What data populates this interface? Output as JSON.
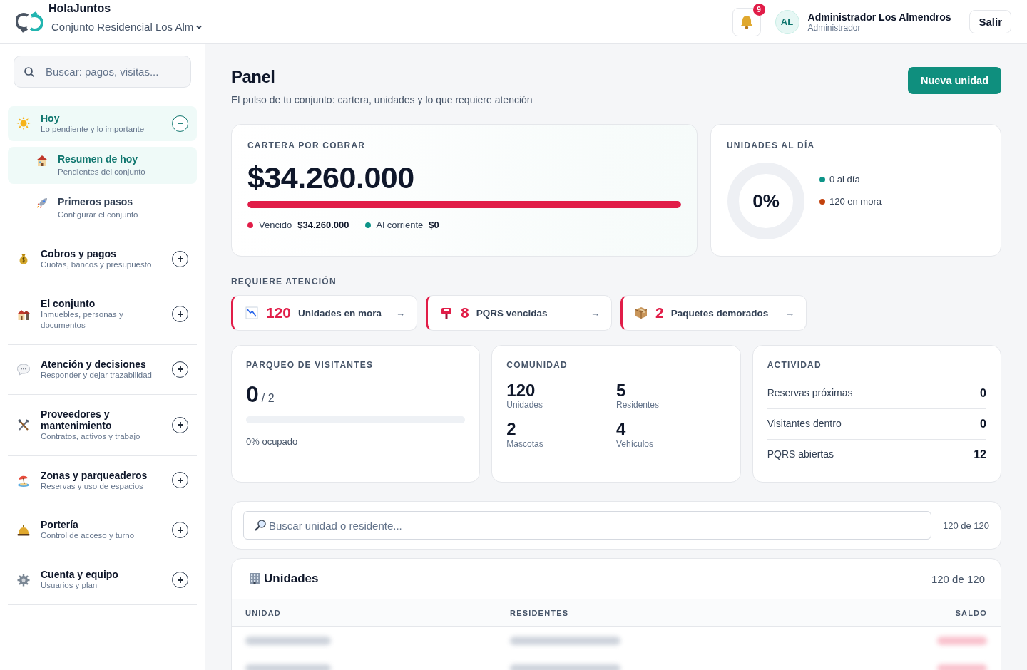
{
  "brand": {
    "name": "HolaJuntos",
    "community": "Conjunto Residencial Los Alm"
  },
  "header": {
    "notifications": "9",
    "user": {
      "initials": "AL",
      "name": "Administrador Los Almendros",
      "role": "Administrador"
    },
    "logout": "Salir"
  },
  "sidebar": {
    "search": {
      "placeholder": "Buscar: pagos, visitas..."
    },
    "sections": [
      {
        "title": "Hoy",
        "subtitle": "Lo pendiente y lo importante",
        "expanded": true,
        "children": [
          {
            "title": "Resumen de hoy",
            "subtitle": "Pendientes del conjunto",
            "selected": true
          },
          {
            "title": "Primeros pasos",
            "subtitle": "Configurar el conjunto",
            "selected": false
          }
        ]
      },
      {
        "title": "Cobros y pagos",
        "subtitle": "Cuotas, bancos y presupuesto",
        "expanded": false
      },
      {
        "title": "El conjunto",
        "subtitle": "Inmuebles, personas y documentos",
        "expanded": false
      },
      {
        "title": "Atención y decisiones",
        "subtitle": "Responder y dejar trazabilidad",
        "expanded": false
      },
      {
        "title": "Proveedores y mantenimiento",
        "subtitle": "Contratos, activos y trabajo",
        "expanded": false
      },
      {
        "title": "Zonas y parqueaderos",
        "subtitle": "Reservas y uso de espacios",
        "expanded": false
      },
      {
        "title": "Portería",
        "subtitle": "Control de acceso y turno",
        "expanded": false
      },
      {
        "title": "Cuenta y equipo",
        "subtitle": "Usuarios y plan",
        "expanded": false
      }
    ]
  },
  "page": {
    "title": "Panel",
    "subtitle": "El pulso de tu conjunto: cartera, unidades y lo que requiere atención",
    "action": "Nueva unidad"
  },
  "receivables": {
    "label": "CARTERA POR COBRAR",
    "amount": "$34.260.000",
    "level": 1,
    "legend": [
      {
        "label": "Vencido",
        "value": "$34.260.000",
        "color": "#e11d48"
      },
      {
        "label": "Al corriente",
        "value": "$0",
        "color": "#0d9488"
      }
    ]
  },
  "units_current": {
    "label": "UNIDADES AL DÍA",
    "percent": "0%",
    "level": 0,
    "legend": [
      {
        "label": "0 al día",
        "color": "#0d9488"
      },
      {
        "label": "120 en mora",
        "color": "#c2410c"
      }
    ]
  },
  "attention": {
    "title": "REQUIERE ATENCIÓN",
    "items": [
      {
        "count": "120",
        "label": "Unidades en mora",
        "arrow": "→"
      },
      {
        "count": "8",
        "label": "PQRS vencidas",
        "arrow": "→"
      },
      {
        "count": "2",
        "label": "Paquetes demorados",
        "arrow": "→"
      }
    ]
  },
  "parking": {
    "label": "PARQUEO DE VISITANTES",
    "value": "0",
    "total": "/ 2",
    "level": 0,
    "caption": "0% ocupado"
  },
  "community": {
    "label": "COMUNIDAD",
    "stats": [
      {
        "value": "120",
        "label": "Unidades"
      },
      {
        "value": "5",
        "label": "Residentes"
      },
      {
        "value": "2",
        "label": "Mascotas"
      },
      {
        "value": "4",
        "label": "Vehículos"
      }
    ]
  },
  "activity": {
    "label": "ACTIVIDAD",
    "rows": [
      {
        "label": "Reservas próximas",
        "value": "0"
      },
      {
        "label": "Visitantes dentro",
        "value": "0"
      },
      {
        "label": "PQRS abiertas",
        "value": "12"
      }
    ]
  },
  "unit_search": {
    "placeholder": "Buscar unidad o residente...",
    "count": "120 de 120"
  },
  "units_table": {
    "title": "Unidades",
    "count": "120 de 120",
    "columns": [
      "UNIDAD",
      "RESIDENTES",
      "SALDO"
    ],
    "rows": [
      {
        "kind": "blurred"
      },
      {
        "kind": "blurred"
      }
    ]
  }
}
